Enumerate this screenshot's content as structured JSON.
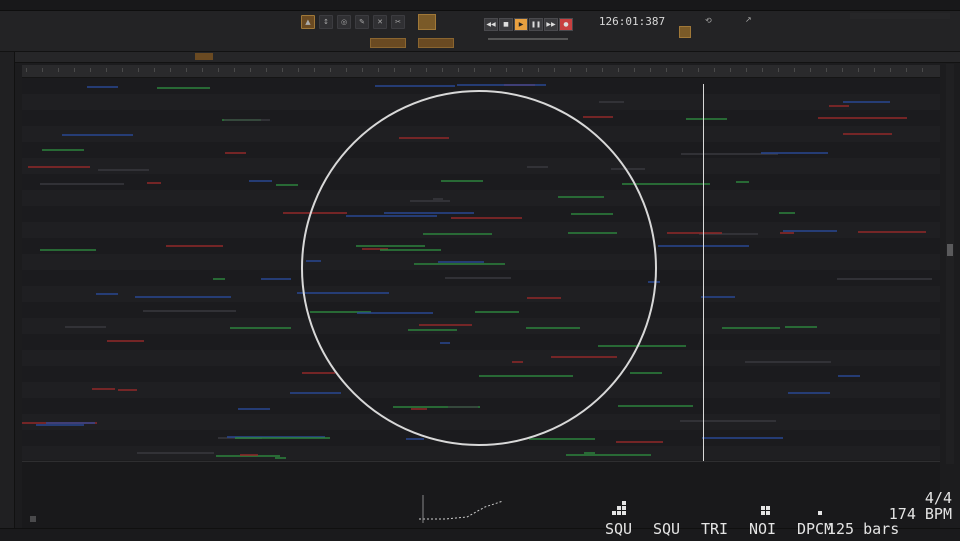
{
  "transport": {
    "time": "126:01:387",
    "buttons": [
      "rewind",
      "stop",
      "play",
      "pause",
      "forward",
      "record"
    ]
  },
  "toolbar": {
    "tools": [
      "pointer-tool",
      "range-tool",
      "stretch-tool",
      "draw-tool",
      "erase-tool",
      "cut-tool"
    ]
  },
  "overlay": {
    "channels": [
      {
        "label": "SQU",
        "bars": [
          1,
          2,
          3
        ]
      },
      {
        "label": "SQU",
        "bars": [
          0,
          0,
          0
        ]
      },
      {
        "label": "TRI",
        "bars": [
          0,
          0,
          0
        ]
      },
      {
        "label": "NOI",
        "bars": [
          0,
          2,
          2
        ]
      },
      {
        "label": "DPCM",
        "bars": [
          0,
          0,
          1
        ]
      }
    ],
    "time_signature": "4/4",
    "bpm": "174 BPM",
    "bars": "125 bars"
  },
  "colors": {
    "accent": "#e8a040",
    "record": "#c84040",
    "clip_green": "#2e8a3e",
    "clip_red": "#9a2a2a",
    "clip_blue": "#2a4a9a",
    "overlay": "#e4e4e4"
  }
}
